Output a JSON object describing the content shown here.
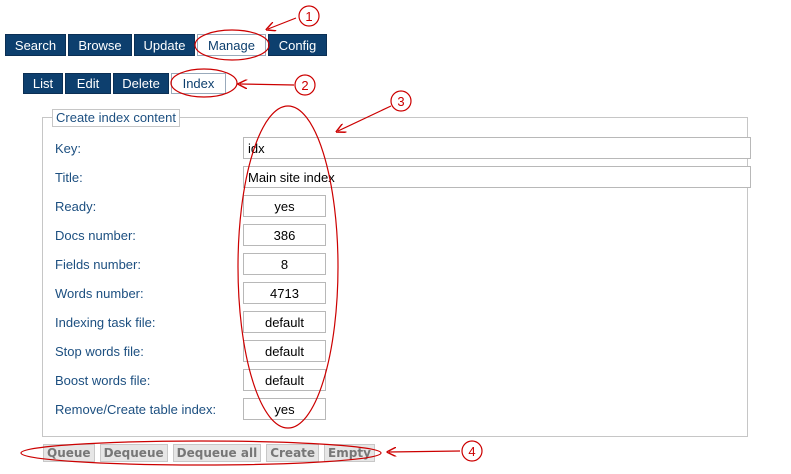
{
  "top_tabs": [
    {
      "label": "Search",
      "active": false
    },
    {
      "label": "Browse",
      "active": false
    },
    {
      "label": "Update",
      "active": false
    },
    {
      "label": "Manage",
      "active": true
    },
    {
      "label": "Config",
      "active": false
    }
  ],
  "sub_tabs": [
    {
      "label": "List",
      "active": false
    },
    {
      "label": "Edit",
      "active": false
    },
    {
      "label": "Delete",
      "active": false
    },
    {
      "label": "Index",
      "active": true
    }
  ],
  "fieldset": {
    "legend": "Create index content",
    "fields": [
      {
        "label": "Key:",
        "value": "idx"
      },
      {
        "label": "Title:",
        "value": "Main site index"
      },
      {
        "label": "Ready:",
        "value": "yes"
      },
      {
        "label": "Docs number:",
        "value": "386"
      },
      {
        "label": "Fields number:",
        "value": "8"
      },
      {
        "label": "Words number:",
        "value": "4713"
      },
      {
        "label": "Indexing task file:",
        "value": "default"
      },
      {
        "label": "Stop words file:",
        "value": "default"
      },
      {
        "label": "Boost words file:",
        "value": "default"
      },
      {
        "label": "Remove/Create table index:",
        "value": "yes"
      }
    ]
  },
  "buttons": {
    "queue": "Queue",
    "dequeue": "Dequeue",
    "dequeue_all": "Dequeue all",
    "create": "Create",
    "empty": "Empty"
  },
  "annotations": {
    "c1": "1",
    "c2": "2",
    "c3": "3",
    "c4": "4"
  },
  "colors": {
    "tab_bg": "#0d3f6e",
    "label": "#1c4f80",
    "annotation": "#cc0000"
  }
}
